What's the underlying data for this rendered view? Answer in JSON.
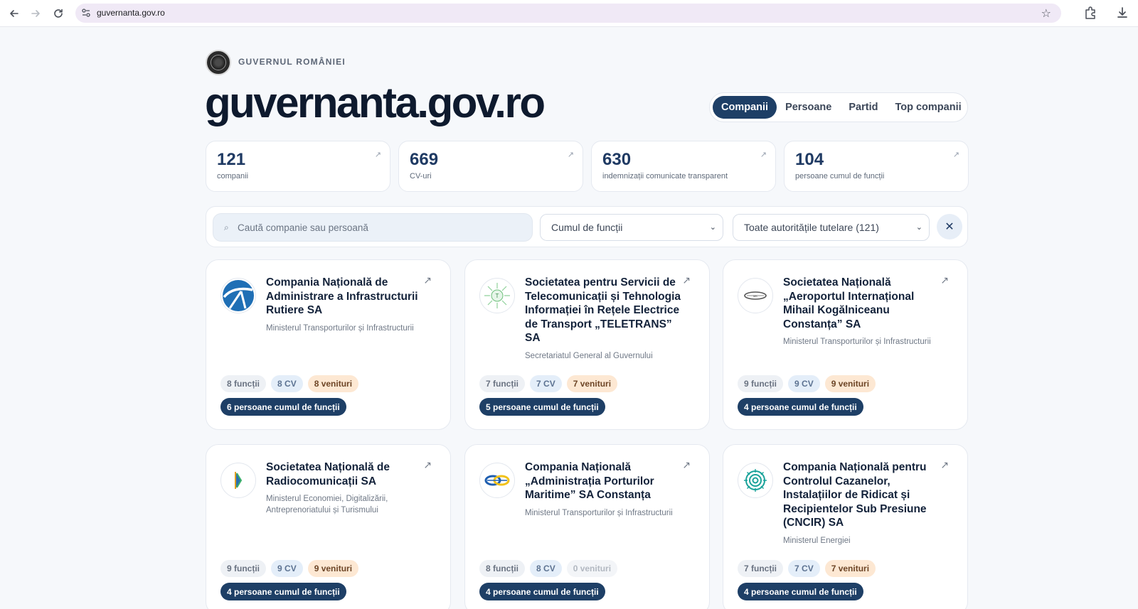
{
  "browser": {
    "url": "guvernanta.gov.ro",
    "back_icon": "back-arrow-icon",
    "forward_icon": "forward-arrow-icon",
    "reload_icon": "reload-icon",
    "bookmark_icon": "star-icon",
    "extensions_icon": "puzzle-icon",
    "download_icon": "download-icon"
  },
  "header": {
    "gov_label": "GUVERNUL ROMÂNIEI",
    "title": "guvernanta.gov.ro",
    "tabs": [
      {
        "label": "Companii",
        "active": true
      },
      {
        "label": "Persoane",
        "active": false
      },
      {
        "label": "Partid",
        "active": false
      },
      {
        "label": "Top companii",
        "active": false
      }
    ]
  },
  "stats": [
    {
      "value": "121",
      "label": "companii"
    },
    {
      "value": "669",
      "label": "CV-uri"
    },
    {
      "value": "630",
      "label": "indemnizații comunicate transparent"
    },
    {
      "value": "104",
      "label": "persoane cumul de funcții"
    }
  ],
  "filters": {
    "search_placeholder": "Caută companie sau persoană",
    "search_icon": "⌕",
    "filter_type": "Cumul de funcții",
    "authority": "Toate autoritățile tutelare (121)",
    "clear_label": "✕"
  },
  "cards": [
    {
      "name": "Compania Națională de Administrare a Infrastructurii Rutiere SA",
      "ministry": "Ministerul Transporturilor și Infrastructurii",
      "functions": "8 funcții",
      "cv": "8 CV",
      "income": "8 venituri",
      "income_zero": false,
      "cumul": "6 persoane cumul de funcții",
      "logo": "cnair-logo"
    },
    {
      "name": "Societatea pentru Servicii de Telecomunicații și Tehnologia Informației în Rețele Electrice de Transport „TELETRANS” SA",
      "ministry": "Secretariatul General al Guvernului",
      "functions": "7 funcții",
      "cv": "7 CV",
      "income": "7 venituri",
      "income_zero": false,
      "cumul": "5 persoane cumul de funcții",
      "logo": "teletrans-logo"
    },
    {
      "name": "Societatea Națională „Aeroportul Internațional Mihail Kogălniceanu Constanța” SA",
      "ministry": "Ministerul Transporturilor și Infrastructurii",
      "functions": "9 funcții",
      "cv": "9 CV",
      "income": "9 venituri",
      "income_zero": false,
      "cumul": "4 persoane cumul de funcții",
      "logo": "airport-logo"
    },
    {
      "name": "Societatea Națională de Radiocomunicații SA",
      "ministry": "Ministerul Economiei, Digitalizării, Antreprenoriatului și Turismului",
      "functions": "9 funcții",
      "cv": "9 CV",
      "income": "9 venituri",
      "income_zero": false,
      "cumul": "4 persoane cumul de funcții",
      "logo": "radiocom-logo"
    },
    {
      "name": "Compania Națională „Administrația Porturilor Maritime” SA Constanța",
      "ministry": "Ministerul Transporturilor și Infrastructurii",
      "functions": "8 funcții",
      "cv": "8 CV",
      "income": "0 venituri",
      "income_zero": true,
      "cumul": "4 persoane cumul de funcții",
      "logo": "apm-logo"
    },
    {
      "name": "Compania Națională pentru Controlul Cazanelor, Instalațiilor de Ridicat și Recipientelor Sub Presiune (CNCIR) SA",
      "ministry": "Ministerul Energiei",
      "functions": "7 funcții",
      "cv": "7 CV",
      "income": "7 venituri",
      "income_zero": false,
      "cumul": "4 persoane cumul de funcții",
      "logo": "cncir-logo"
    }
  ],
  "colors": {
    "primary": "#1e3f66",
    "background": "#f6f8fb",
    "stat_number": "#1f3a63",
    "income_chip": "#fde8d3"
  }
}
